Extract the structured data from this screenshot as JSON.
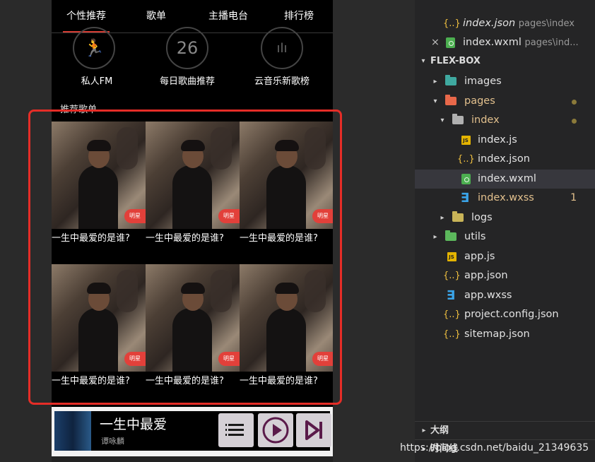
{
  "phone": {
    "tabs": [
      {
        "label": "个性推荐"
      },
      {
        "label": "歌单"
      },
      {
        "label": "主播电台"
      },
      {
        "label": "排行榜"
      }
    ],
    "nav_icons": [
      {
        "label": "私人FM",
        "icon": "running-figure-icon",
        "glyph": "🏃"
      },
      {
        "label": "每日歌曲推荐",
        "icon": "calendar-day-icon",
        "glyph": "26"
      },
      {
        "label": "云音乐新歌榜",
        "icon": "chart-bars-icon",
        "glyph": "ılı"
      }
    ],
    "section_title": "推荐歌单",
    "songs": [
      {
        "title": "一生中最爱的是谁?",
        "badge": "明星"
      },
      {
        "title": "一生中最爱的是谁?",
        "badge": "明星"
      },
      {
        "title": "一生中最爱的是谁?",
        "badge": "明星"
      },
      {
        "title": "一生中最爱的是谁?",
        "badge": "明星"
      },
      {
        "title": "一生中最爱的是谁?",
        "badge": "明星"
      },
      {
        "title": "一生中最爱的是谁?",
        "badge": "明星"
      }
    ],
    "player": {
      "title": "一生中最爱",
      "artist": "谭咏麟",
      "controls": [
        "playlist-icon",
        "play-icon",
        "next-icon"
      ]
    },
    "highlight_color": "#e52d27"
  },
  "explorer": {
    "open_editors": [
      {
        "name": "index.json",
        "desc": "pages\\index"
      },
      {
        "name": "index.wxml",
        "desc": "pages\\ind..."
      }
    ],
    "section_title": "FLEX-BOX",
    "tree": [
      {
        "name": "images",
        "type": "folder"
      },
      {
        "name": "pages",
        "type": "folder"
      },
      {
        "name": "index",
        "type": "folder"
      },
      {
        "name": "index.js",
        "type": "js"
      },
      {
        "name": "index.json",
        "type": "json"
      },
      {
        "name": "index.wxml",
        "type": "wxml"
      },
      {
        "name": "index.wxss",
        "type": "wxss",
        "badge": "1"
      },
      {
        "name": "logs",
        "type": "folder"
      },
      {
        "name": "utils",
        "type": "folder"
      },
      {
        "name": "app.js",
        "type": "js"
      },
      {
        "name": "app.json",
        "type": "json"
      },
      {
        "name": "app.wxss",
        "type": "wxss"
      },
      {
        "name": "project.config.json",
        "type": "json"
      },
      {
        "name": "sitemap.json",
        "type": "json"
      }
    ],
    "outline_title": "大纲",
    "timeline_title": "时间线",
    "colors": {
      "modified": "#e2c08d",
      "selected_row": "#37373d",
      "folder_images": "#3fa9a0",
      "folder_pages": "#e8684a",
      "folder_generic": "#c9b458",
      "folder_utils": "#5cb85c"
    }
  },
  "watermark": "https://blog.csdn.net/baidu_21349635"
}
